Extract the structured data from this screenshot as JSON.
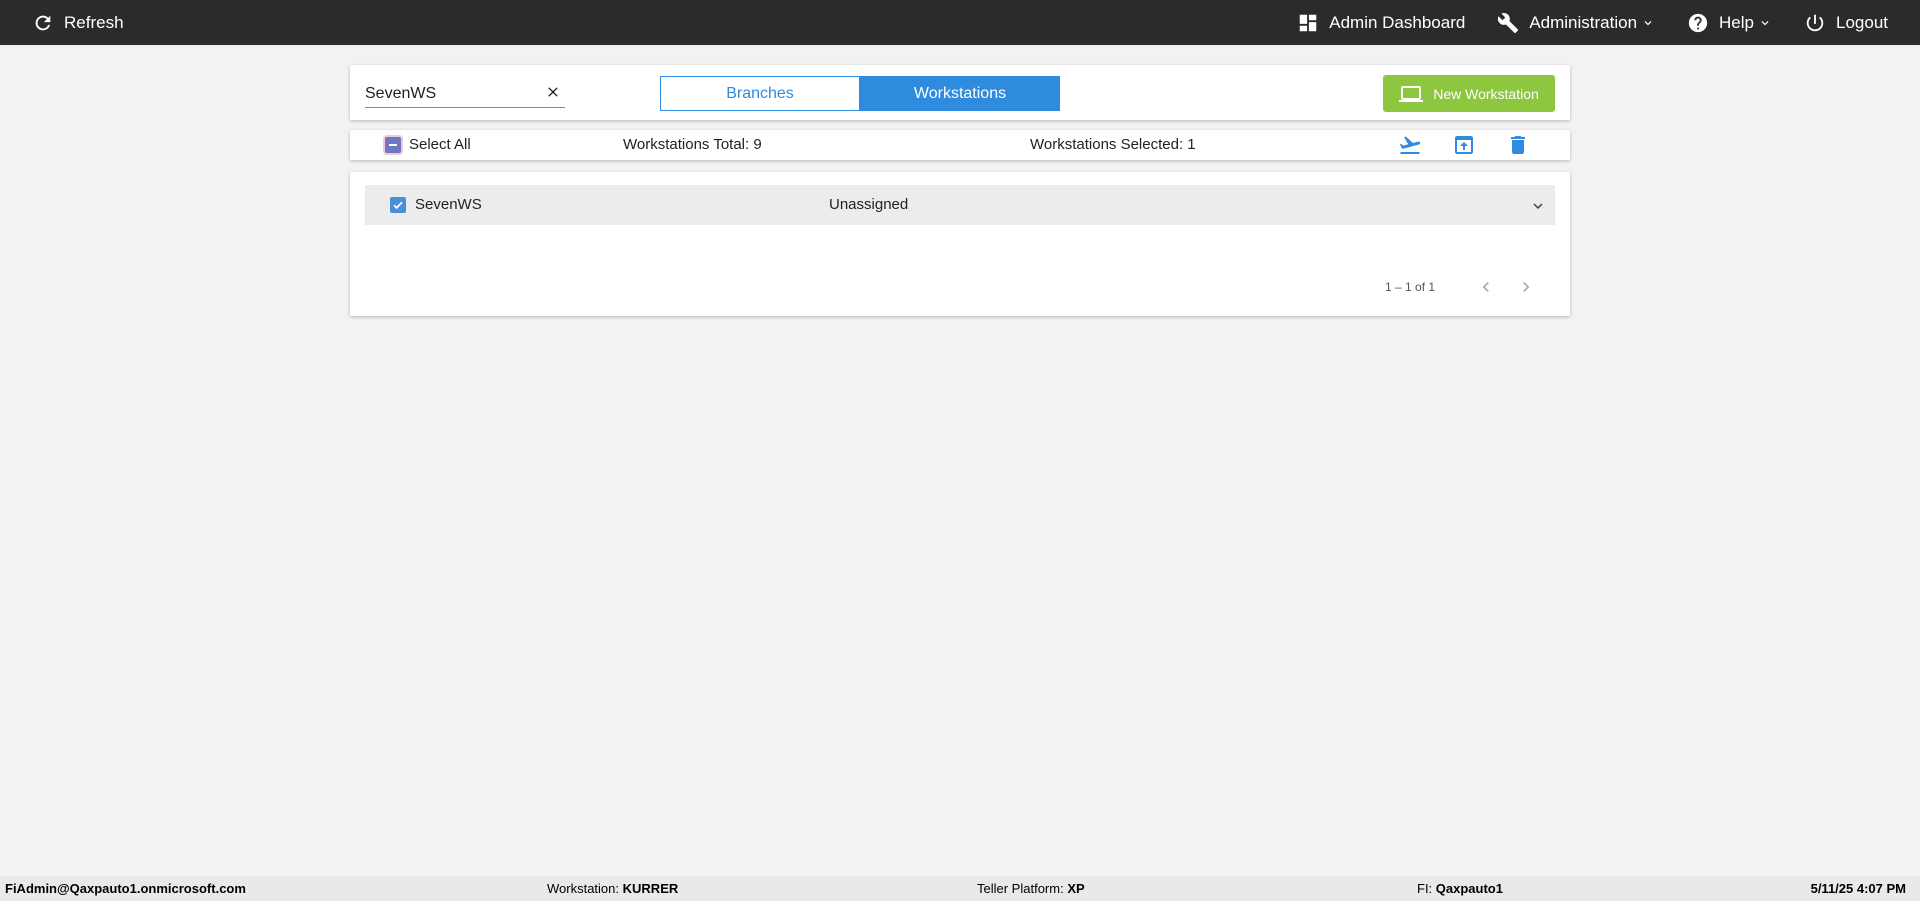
{
  "topbar": {
    "refresh_label": "Refresh",
    "admin_dashboard_label": "Admin Dashboard",
    "administration_label": "Administration",
    "help_label": "Help",
    "logout_label": "Logout"
  },
  "search": {
    "value": "SevenWS",
    "placeholder": ""
  },
  "toggle": {
    "branches_label": "Branches",
    "workstations_label": "Workstations",
    "active": "Workstations"
  },
  "new_button_label": "New Workstation",
  "summary": {
    "select_all_label": "Select All",
    "select_all_state": "indeterminate",
    "total_text": "Workstations Total: 9",
    "selected_text": "Workstations Selected: 1"
  },
  "list": {
    "rows": [
      {
        "name": "SevenWS",
        "status": "Unassigned",
        "checked": true
      }
    ],
    "pagination_text": "1 – 1 of 1"
  },
  "footer": {
    "user": "FiAdmin@Qaxpauto1.onmicrosoft.com",
    "workstation_label": "Workstation:",
    "workstation_value": "KURRER",
    "teller_platform_label": "Teller Platform:",
    "teller_platform_value": "XP",
    "fi_label": "FI:",
    "fi_value": "Qaxpauto1",
    "datetime": "5/11/25 4:07 PM"
  },
  "colors": {
    "topbar": "#2b2b2b",
    "accent_blue": "#2e8bdd",
    "new_button_green": "#8dc63f",
    "background": "#f2f2f2"
  },
  "icons": {
    "refresh": "refresh-icon",
    "admin_dashboard": "dashboard-icon",
    "administration": "wrench-icon",
    "help": "help-circle-icon",
    "logout": "power-icon",
    "new_workstation": "laptop-icon",
    "actions": [
      "flight-takeoff-icon",
      "upload-box-icon",
      "trash-icon"
    ]
  }
}
